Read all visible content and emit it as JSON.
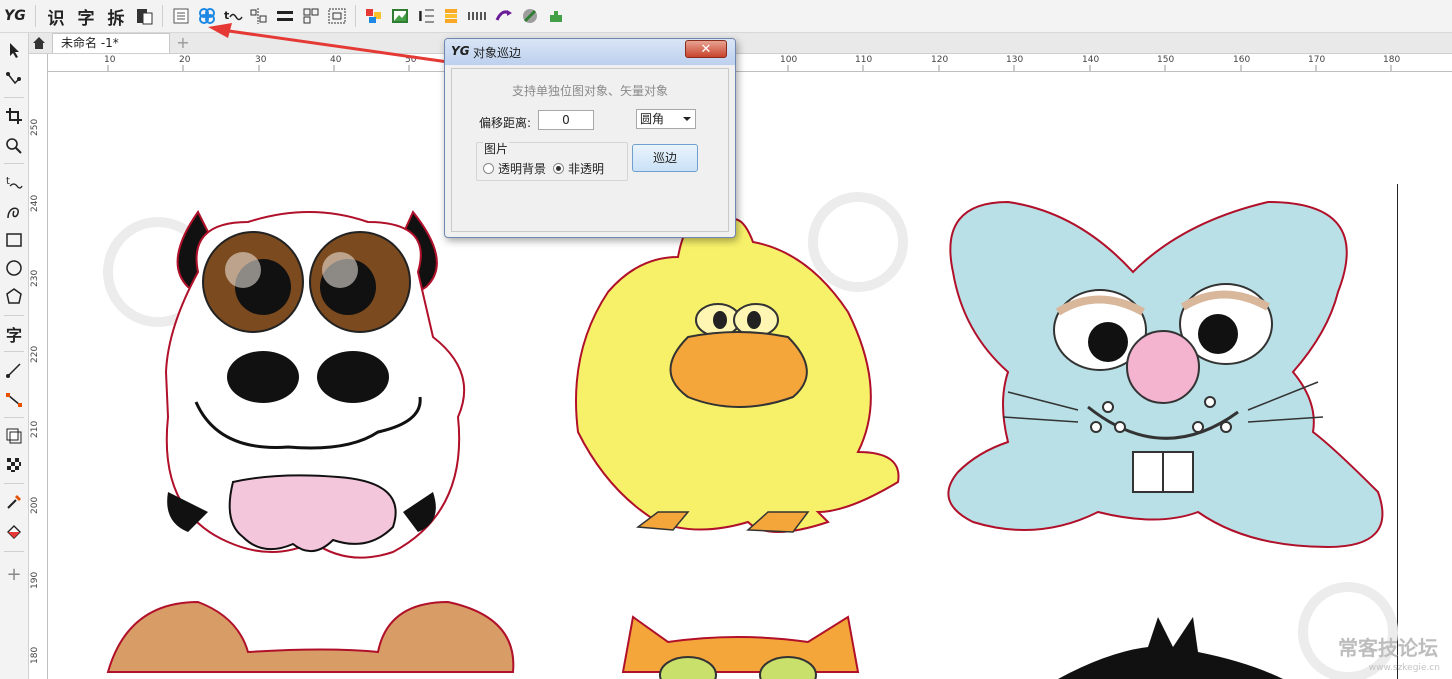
{
  "app": {
    "logo": "YG",
    "accent": "#1e88e5",
    "arrow_color": "#e53935",
    "outline_color": "#b0102a"
  },
  "toolbar": {
    "text_buttons": [
      "识",
      "字",
      "拆"
    ],
    "icons": [
      "clipboard-icon",
      "list-icon",
      "flower-icon",
      "wave-icon",
      "align-icon",
      "lines-icon",
      "grid-icon",
      "select-grid-icon",
      "shapes-icon",
      "image-icon",
      "text-frame-icon",
      "layers-icon",
      "dots-icon",
      "shuffle-icon",
      "globe-icon",
      "puzzle-icon"
    ]
  },
  "tabs": {
    "document": "未命名 -1*",
    "add": "+"
  },
  "toolbox": {
    "text_tool": "字",
    "add": "+"
  },
  "rulers": {
    "h_labels": [
      "10",
      "20",
      "30",
      "40",
      "50",
      "100",
      "110",
      "120",
      "130",
      "140",
      "150",
      "160",
      "170",
      "180"
    ],
    "v_labels": [
      "250",
      "240",
      "230",
      "220",
      "210",
      "200",
      "190",
      "180"
    ]
  },
  "dialog": {
    "logo": "YG",
    "title": "对象巡边",
    "close": "✕",
    "hint": "支持单独位图对象、矢量对象",
    "offset_label": "偏移距离:",
    "offset_value": "0",
    "corner_value": "圆角",
    "picture_group": "图片",
    "radio_transparent": "透明背景",
    "radio_opaque": "非透明",
    "selected_radio": "非透明",
    "run_button": "巡边"
  },
  "watermark": {
    "text": "常客技论坛",
    "sub": "www.szkegie.cn"
  }
}
